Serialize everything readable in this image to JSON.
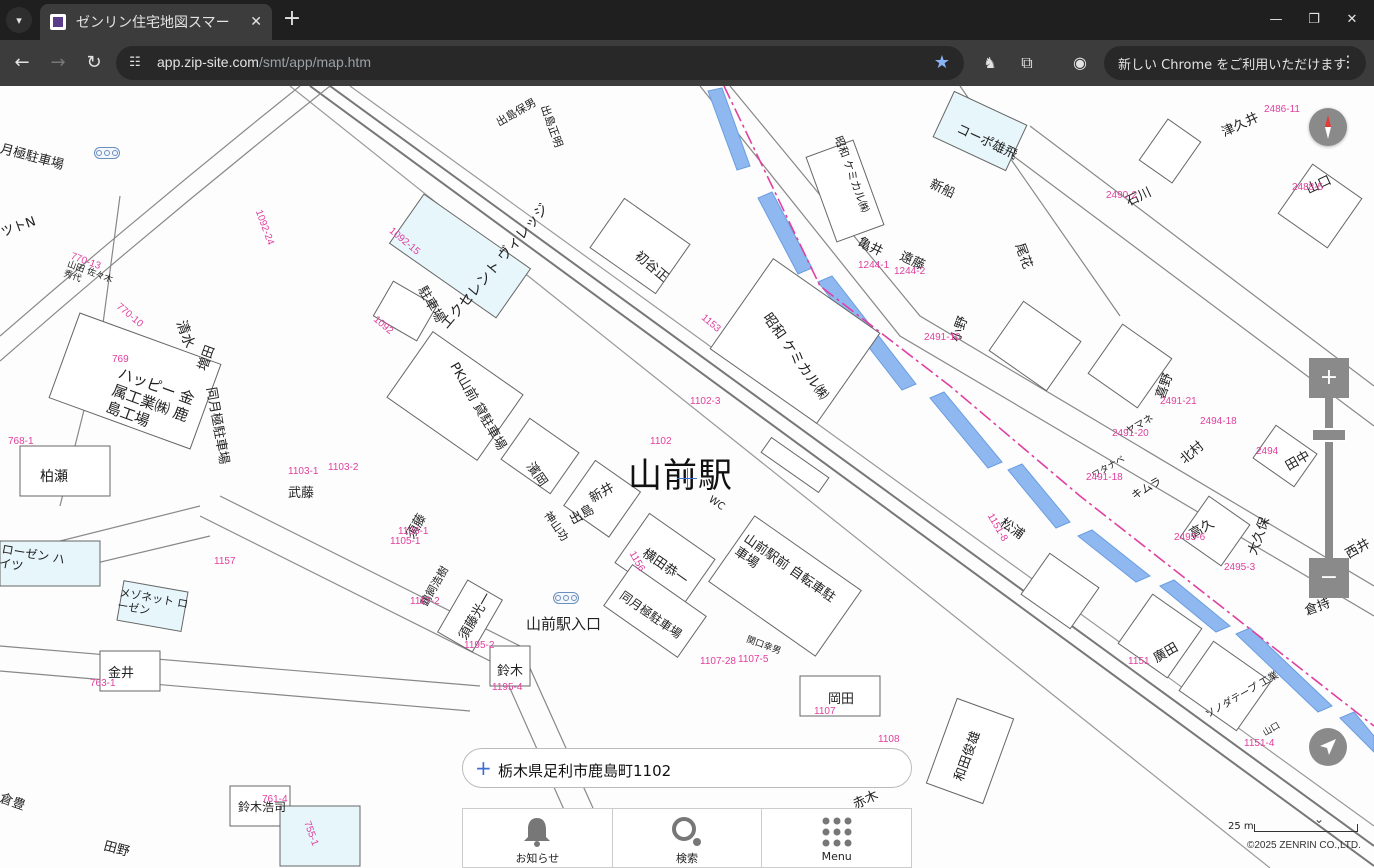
{
  "browser": {
    "tab_title": "ゼンリン住宅地図スマー",
    "url_host": "app.zip-site.com",
    "url_path": "/smt/app/map.htm",
    "update_text": "新しい Chrome をご利用いただけます"
  },
  "map": {
    "station": "山前駅",
    "bus_stop": "山前駅入口",
    "buildings": [
      "エクセレント ヴィレッジ",
      "駐車場",
      "PK山前 貸駐車場",
      "初谷正",
      "昭和 ケミカル㈱",
      "昭和 ケミカル㈱",
      "コーポ雄飛",
      "新船",
      "亀井",
      "遠藤",
      "尾花",
      "小野",
      "石川",
      "山口",
      "津久井",
      "ハッピー 金属工業㈱ 鹿島工場",
      "柏瀬",
      "清水",
      "増田",
      "同月極駐車場",
      "武藤",
      "須藤",
      "濱岡",
      "新井",
      "出島",
      "神山功",
      "横田恭一",
      "山前駅前 自転車駐車場",
      "同月極駐車場",
      "須藤光一",
      "鈴木",
      "金井",
      "岡田",
      "和田俊雄",
      "赤木",
      "鈴木浩司",
      "田野",
      "倉豊",
      "松浦",
      "喜野",
      "北村",
      "田中",
      "キムラ",
      "高久",
      "大久保",
      "西井",
      "倉持",
      "廣田",
      "ソノダテープ 工業",
      "ヤマネ",
      "ワタナベ",
      "山口",
      "ローゼン ハイツ",
      "メゾネット ローゼン",
      "ツトN",
      "月極駐車場",
      "出島正明",
      "山田 佐々木秀代",
      "WC",
      "関口幸男",
      "出島保男",
      "鶴飼浩樹"
    ],
    "parcel_numbers": [
      "1092-15",
      "1092",
      "1153",
      "1092-24",
      "770-13",
      "770-10",
      "769",
      "768-1",
      "1157",
      "1103-1",
      "1156",
      "1106-1",
      "1107",
      "1195-4",
      "763-1",
      "761-4",
      "755-1",
      "1108",
      "1151-8",
      "1151",
      "2491-10",
      "2491-20",
      "2491-18",
      "2494-18",
      "2494",
      "2495-3",
      "2495-6",
      "1244-1",
      "1244-2",
      "1102",
      "2488-5",
      "2486-11",
      "2490-2",
      "1151-4",
      "1107-5",
      "1105-1",
      "1103-2",
      "2491-21",
      "1102-3",
      "1107-28",
      "1195-2",
      "1117-2"
    ],
    "copyright": "©2025 ZENRIN CO.,LTD.",
    "scale_label": "25 m",
    "address": "栃木県足利市鹿島町1102"
  },
  "nav": {
    "notice": "お知らせ",
    "search": "検索",
    "menu": "Menu"
  }
}
